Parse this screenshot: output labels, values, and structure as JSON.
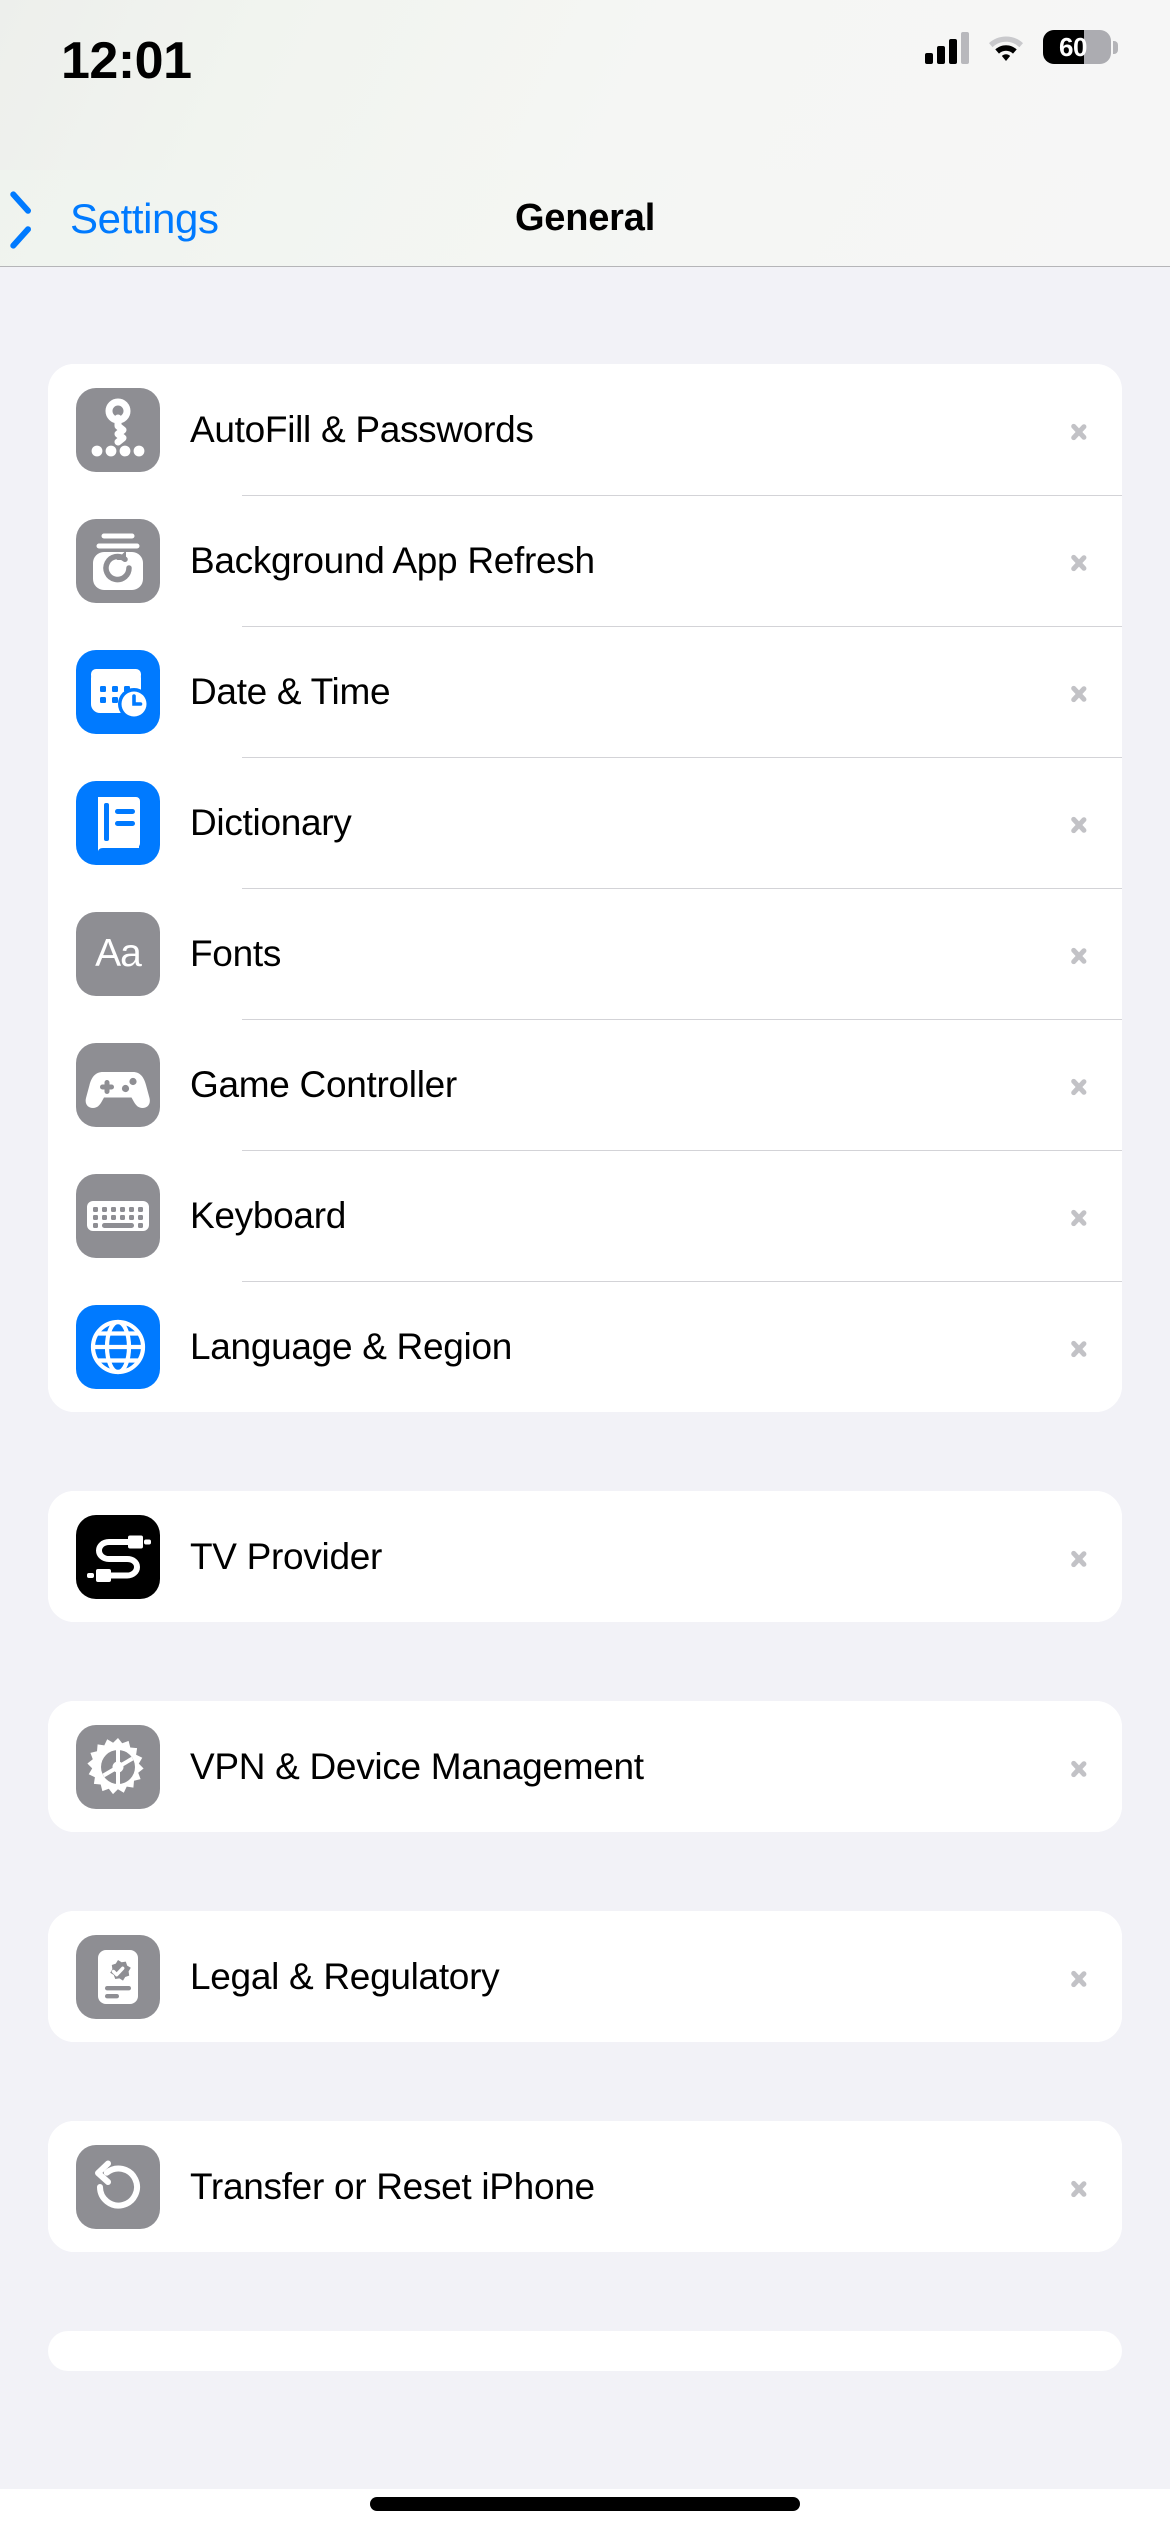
{
  "status_bar": {
    "time": "12:01",
    "battery_level": "60",
    "battery_percent": 60,
    "cellular_icon": "cellular-signal-icon",
    "wifi_icon": "wifi-icon",
    "battery_icon": "battery-icon"
  },
  "nav": {
    "back_label": "Settings",
    "back_icon": "chevron-left-icon",
    "title": "General"
  },
  "accent_color": "#007AFF",
  "colors": {
    "page_background": "#F2F2F7",
    "card_background": "#FFFFFF",
    "separator": "#D3D3D7",
    "chevron": "#C2C2C6",
    "icon_gray": "#8E8E93",
    "icon_blue": "#007AFF",
    "icon_black": "#000000",
    "label": "#000000"
  },
  "groups": [
    {
      "rows": [
        {
          "label": "AutoFill & Passwords",
          "icon": "key-passwords-icon",
          "icon_style": "gray",
          "disclosure": "chevron-right-icon"
        },
        {
          "label": "Background App Refresh",
          "icon": "background-app-refresh-icon",
          "icon_style": "gray",
          "disclosure": "chevron-right-icon"
        },
        {
          "label": "Date & Time",
          "icon": "calendar-clock-icon",
          "icon_style": "blue",
          "disclosure": "chevron-right-icon"
        },
        {
          "label": "Dictionary",
          "icon": "book-icon",
          "icon_style": "blue",
          "disclosure": "chevron-right-icon"
        },
        {
          "label": "Fonts",
          "icon": "fonts-aa-icon",
          "icon_style": "gray",
          "disclosure": "chevron-right-icon"
        },
        {
          "label": "Game Controller",
          "icon": "game-controller-icon",
          "icon_style": "gray",
          "disclosure": "chevron-right-icon"
        },
        {
          "label": "Keyboard",
          "icon": "keyboard-icon",
          "icon_style": "gray",
          "disclosure": "chevron-right-icon"
        },
        {
          "label": "Language & Region",
          "icon": "globe-icon",
          "icon_style": "blue",
          "disclosure": "chevron-right-icon"
        }
      ]
    },
    {
      "rows": [
        {
          "label": "TV Provider",
          "icon": "tv-provider-cable-icon",
          "icon_style": "black",
          "disclosure": "chevron-right-icon"
        }
      ]
    },
    {
      "rows": [
        {
          "label": "VPN & Device Management",
          "icon": "gear-icon",
          "icon_style": "gray",
          "disclosure": "chevron-right-icon"
        }
      ]
    },
    {
      "rows": [
        {
          "label": "Legal & Regulatory",
          "icon": "legal-document-icon",
          "icon_style": "gray",
          "disclosure": "chevron-right-icon"
        }
      ]
    },
    {
      "rows": [
        {
          "label": "Transfer or Reset iPhone",
          "icon": "reset-arrow-icon",
          "icon_style": "gray",
          "disclosure": "chevron-right-icon"
        }
      ]
    }
  ],
  "fonts_icon_text": "Aa"
}
